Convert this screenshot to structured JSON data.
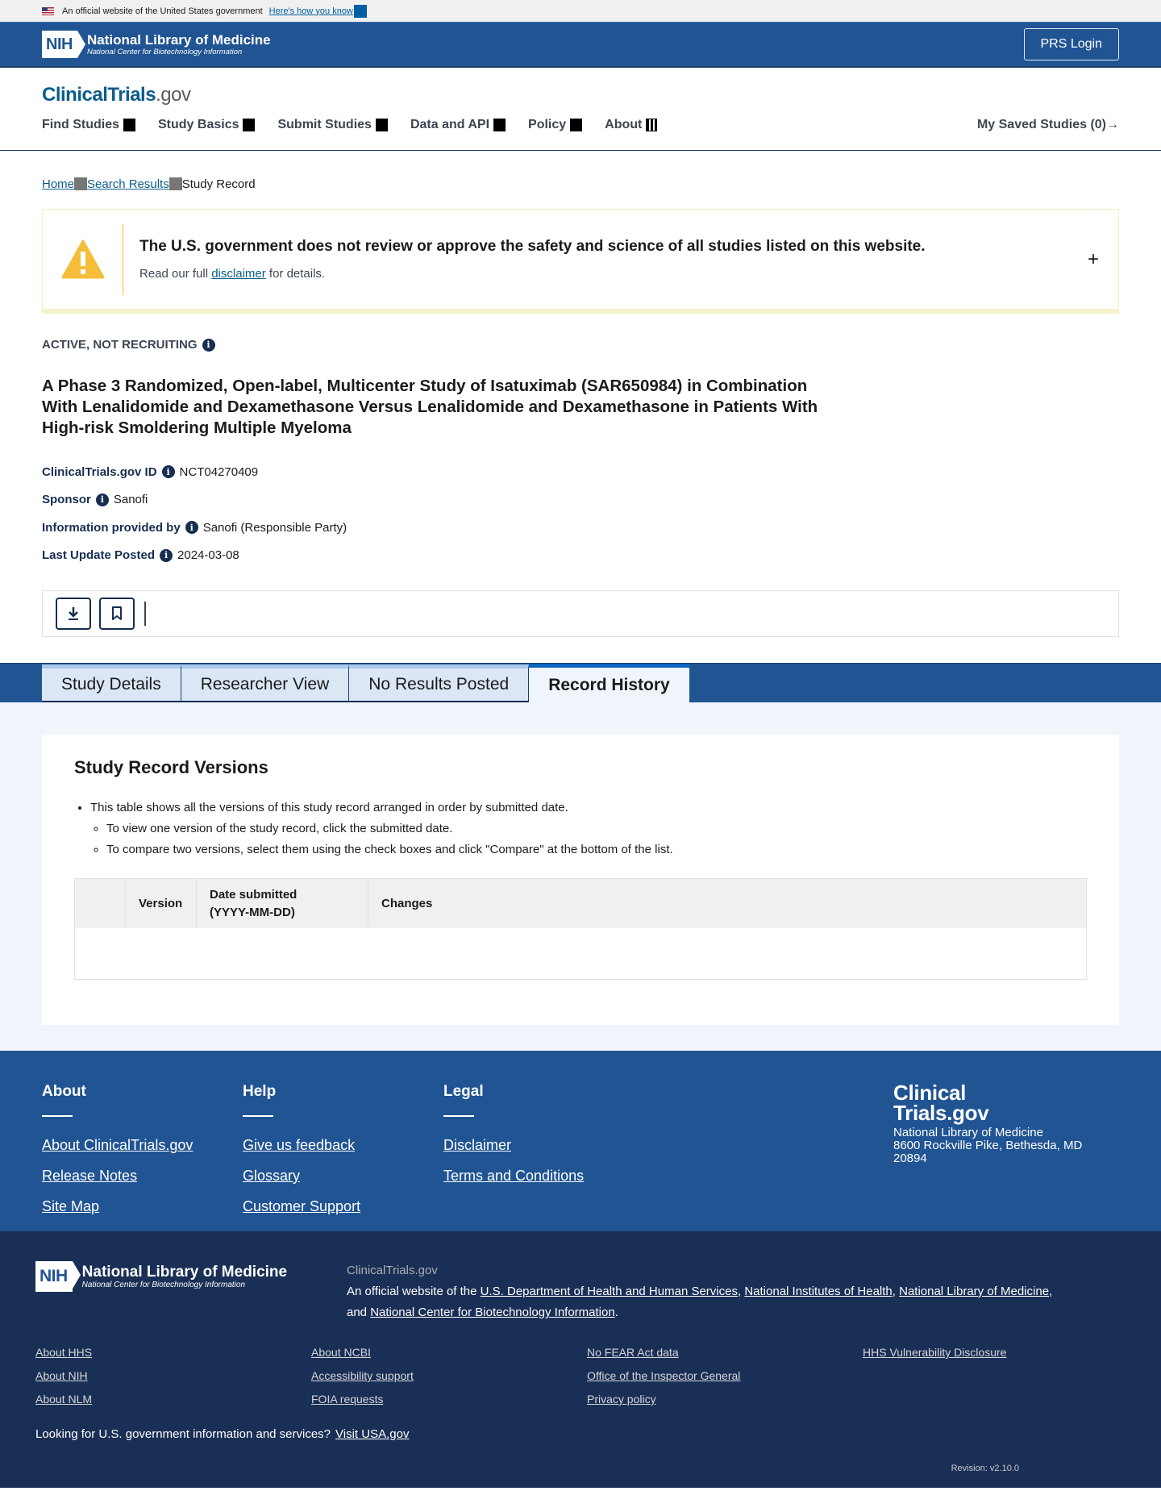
{
  "gov_banner": {
    "text": "An official website of the United States government",
    "link": "Here's how you know"
  },
  "nih_header": {
    "badge": "NIH",
    "title": "National Library of Medicine",
    "subtitle": "National Center for Biotechnology Information",
    "login_button": "PRS Login"
  },
  "site": {
    "logo_main": "ClinicalTrials",
    "logo_suffix": ".gov",
    "nav": [
      "Find Studies",
      "Study Basics",
      "Submit Studies",
      "Data and API",
      "Policy",
      "About"
    ],
    "saved_studies": "My Saved Studies (0)",
    "saved_arrow": "→"
  },
  "breadcrumb": {
    "items": [
      "Home",
      "Search Results"
    ],
    "current": "Study Record"
  },
  "disclaimer": {
    "title": "The U.S. government does not review or approve the safety and science of all studies listed on this website.",
    "sub_before": "Read our full ",
    "sub_link": "disclaimer",
    "sub_after": " for details.",
    "expand": "+"
  },
  "study": {
    "status": "ACTIVE, NOT RECRUITING",
    "title": "A Phase 3 Randomized, Open-label, Multicenter Study of Isatuximab (SAR650984) in Combination With Lenalidomide and Dexamethasone Versus Lenalidomide and Dexamethasone in Patients With High-risk Smoldering Multiple Myeloma",
    "meta": [
      {
        "label": "ClinicalTrials.gov ID",
        "value": "NCT04270409"
      },
      {
        "label": "Sponsor",
        "value": "Sanofi"
      },
      {
        "label": "Information provided by",
        "value": "Sanofi (Responsible Party)"
      },
      {
        "label": "Last Update Posted",
        "value": "2024-03-08"
      }
    ]
  },
  "toolbar": {
    "download_icon": "download-icon",
    "bookmark_icon": "bookmark-icon"
  },
  "tabs": [
    {
      "label": "Study Details",
      "active": false
    },
    {
      "label": "Researcher View",
      "active": false
    },
    {
      "label": "No Results Posted",
      "active": false
    },
    {
      "label": "Record History",
      "active": true
    }
  ],
  "record_history": {
    "heading": "Study Record Versions",
    "bullet_main": "This table shows all the versions of this study record arranged in order by submitted date.",
    "bullet_sub": [
      "To view one version of the study record, click the submitted date.",
      "To compare two versions, select them using the check boxes and click \"Compare\" at the bottom of the list."
    ],
    "table": {
      "headers": [
        "",
        "Version",
        "Date submitted (YYYY-MM-DD)",
        "Changes"
      ],
      "header_date_line1": "Date submitted",
      "header_date_line2": "(YYYY-MM-DD)",
      "rows": []
    }
  },
  "footer": {
    "columns": [
      {
        "heading": "About",
        "links": [
          "About ClinicalTrials.gov",
          "Release Notes",
          "Site Map"
        ]
      },
      {
        "heading": "Help",
        "links": [
          "Give us feedback",
          "Glossary",
          "Customer Support"
        ]
      },
      {
        "heading": "Legal",
        "links": [
          "Disclaimer",
          "Terms and Conditions"
        ]
      }
    ],
    "brand_line1": "Clinical",
    "brand_line2": "Trials.gov",
    "address_line1": "National Library of Medicine",
    "address_line2": "8600 Rockville Pike, Bethesda, MD",
    "address_line3": "20894"
  },
  "footer_bottom": {
    "nih_badge": "NIH",
    "nih_title": "National Library of Medicine",
    "nih_subtitle": "National Center for Biotechnology Information",
    "site_name": "ClinicalTrials.gov",
    "official_prefix": "An official website of the ",
    "links_inline": [
      "U.S. Department of Health and Human Services",
      "National Institutes of Health",
      "National Library of Medicine",
      "National Center for Biotechnology Information"
    ],
    "and_text": "and ",
    "links_grid": [
      [
        "About HHS",
        "About NIH",
        "About NLM"
      ],
      [
        "About NCBI",
        "Accessibility support",
        "FOIA requests"
      ],
      [
        "No FEAR Act data",
        "Office of the Inspector General",
        "Privacy policy"
      ],
      [
        "HHS Vulnerability Disclosure"
      ]
    ],
    "usa_text": "Looking for U.S. government information and services?",
    "usa_link": "Visit USA.gov",
    "revision": "Revision: v2.10.0"
  }
}
